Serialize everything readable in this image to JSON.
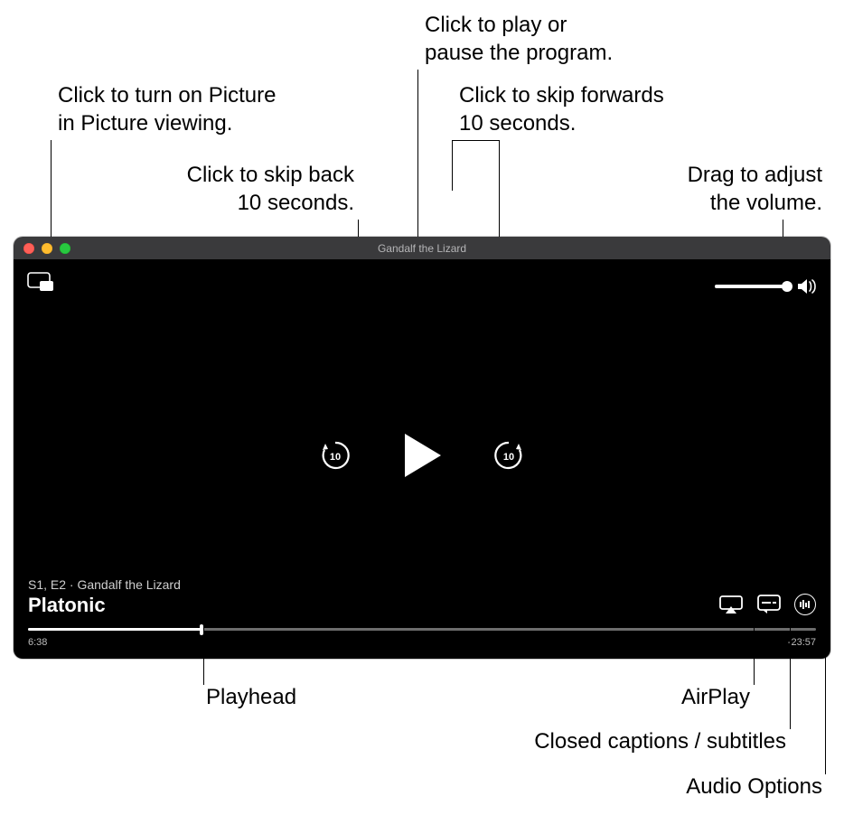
{
  "callouts": {
    "pip": "Click to turn on Picture\nin Picture viewing.",
    "play": "Click to play or\npause the program.",
    "skip_back": "Click to skip back\n10 seconds.",
    "skip_fwd": "Click to skip forwards\n10 seconds.",
    "volume": "Drag to adjust\nthe volume.",
    "playhead": "Playhead",
    "airplay": "AirPlay",
    "cc": "Closed captions / subtitles",
    "audio_opts": "Audio Options"
  },
  "window": {
    "title": "Gandalf the Lizard"
  },
  "playback": {
    "episode_info": "S1, E2 · Gandalf the Lizard",
    "show_title": "Platonic",
    "time_elapsed": "6:38",
    "time_remaining": "-23:57",
    "progress_pct": 22,
    "skip_seconds": "10",
    "volume_pct": 100
  },
  "icons": {
    "pip": "pip-icon",
    "speaker": "speaker-icon",
    "play": "play-icon",
    "skip_back": "skip-back-10-icon",
    "skip_fwd": "skip-forward-10-icon",
    "airplay": "airplay-icon",
    "captions": "captions-icon",
    "audio_opts": "audio-options-icon"
  }
}
